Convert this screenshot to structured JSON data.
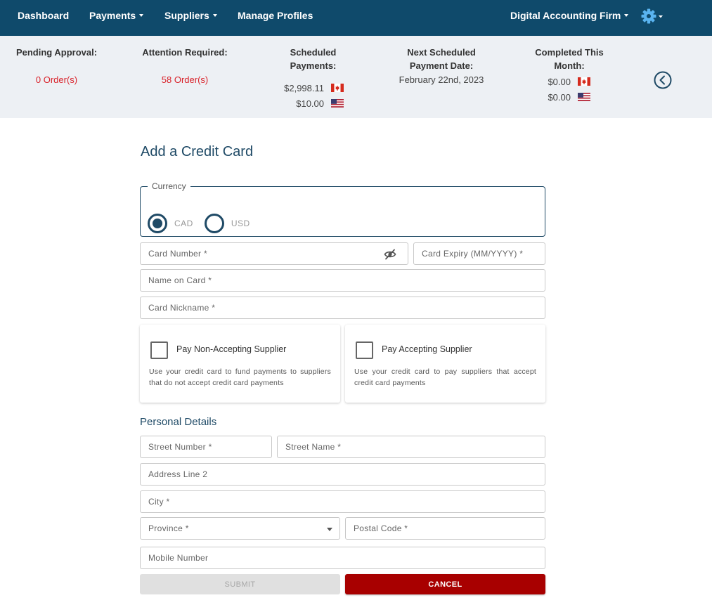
{
  "nav": {
    "items": [
      {
        "label": "Dashboard",
        "dropdown": false
      },
      {
        "label": "Payments",
        "dropdown": true
      },
      {
        "label": "Suppliers",
        "dropdown": true
      },
      {
        "label": "Manage Profiles",
        "dropdown": false
      }
    ],
    "firm_label": "Digital Accounting Firm",
    "settings_icon": "gear-icon",
    "bar_color": "#0f4a6b",
    "gear_color": "#5ab4f0"
  },
  "summary": {
    "pending": {
      "label": "Pending Approval:",
      "value": "0 Order(s)"
    },
    "attention": {
      "label": "Attention Required:",
      "value": "58 Order(s)"
    },
    "scheduled": {
      "label": "Scheduled Payments:",
      "cad": "$2,998.11",
      "usd": "$10.00"
    },
    "next_date": {
      "label_line1": "Next Scheduled",
      "label_line2": "Payment Date:",
      "value": "February 22nd, 2023"
    },
    "completed": {
      "label_line1": "Completed This",
      "label_line2": "Month:",
      "cad": "$0.00",
      "usd": "$0.00"
    },
    "collapse_icon": "chevron-left-circle-icon",
    "alert_color": "#d9222a"
  },
  "form": {
    "title": "Add a Credit Card",
    "currency": {
      "legend": "Currency",
      "options": [
        "CAD",
        "USD"
      ],
      "selected": "CAD"
    },
    "card_number": {
      "placeholder": "Card Number *"
    },
    "card_expiry": {
      "placeholder": "Card Expiry (MM/YYYY) *"
    },
    "name_on_card": {
      "placeholder": "Name on Card *"
    },
    "card_nickname": {
      "placeholder": "Card Nickname *"
    },
    "options": [
      {
        "title": "Pay Non-Accepting Supplier",
        "description": "Use your credit card to fund payments to suppliers that do not accept credit card payments",
        "checked": false
      },
      {
        "title": "Pay Accepting Supplier",
        "description": "Use your credit card to pay suppliers that accept credit card payments",
        "checked": false
      }
    ]
  },
  "personal": {
    "title": "Personal Details",
    "street_number": {
      "placeholder": "Street Number *"
    },
    "street_name": {
      "placeholder": "Street Name *"
    },
    "address_line2": {
      "placeholder": "Address Line 2"
    },
    "city": {
      "placeholder": "City *"
    },
    "province": {
      "placeholder": "Province *"
    },
    "postal_code": {
      "placeholder": "Postal Code *"
    },
    "mobile": {
      "placeholder": "Mobile Number"
    }
  },
  "buttons": {
    "submit": "SUBMIT",
    "cancel": "CANCEL",
    "accent": "#1f4a66",
    "cancel_color": "#a80000"
  }
}
